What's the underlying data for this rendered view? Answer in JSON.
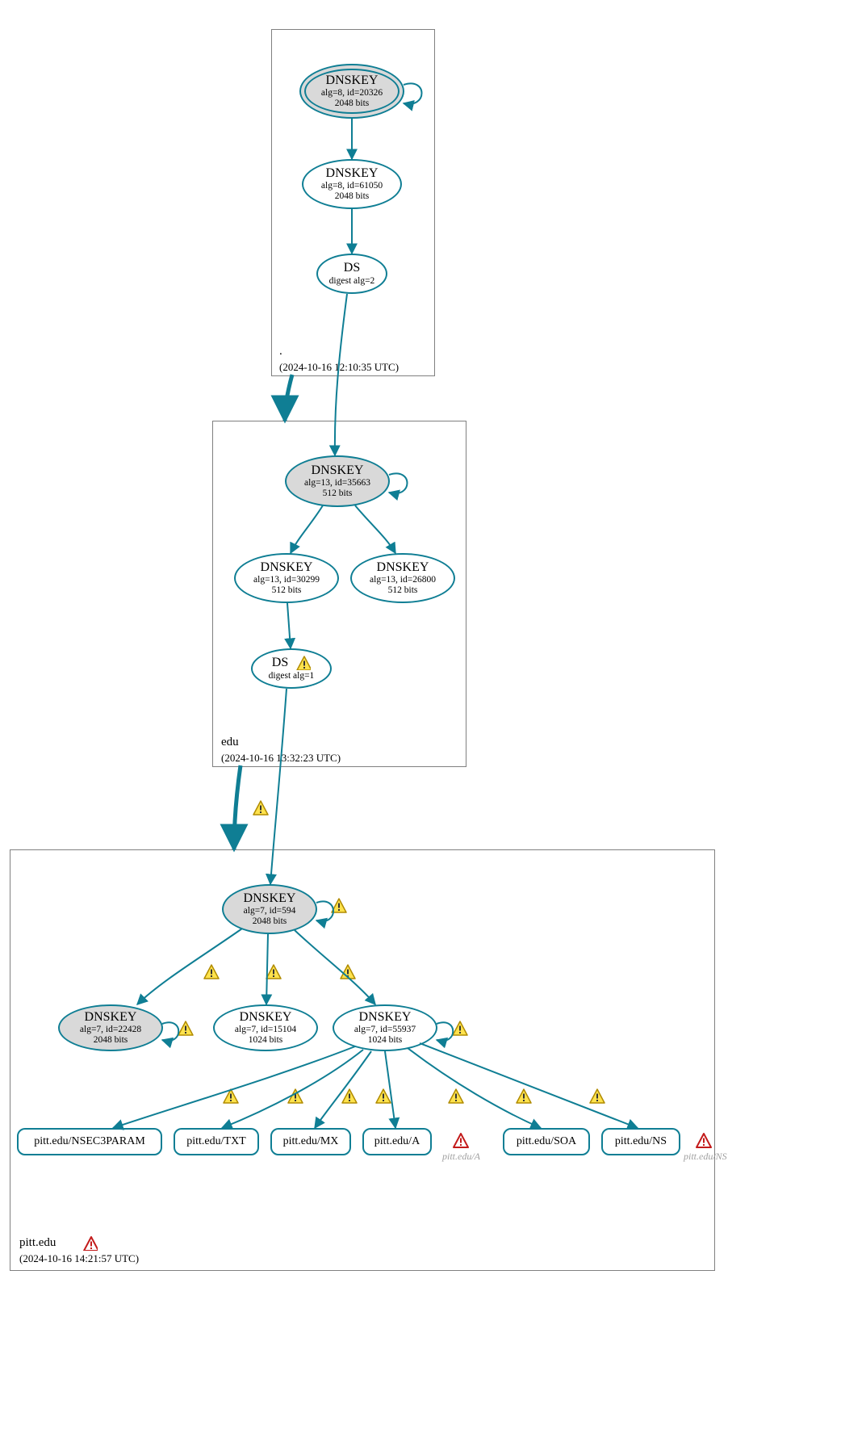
{
  "zones": {
    "root": {
      "name": ".",
      "timestamp": "(2024-10-16 12:10:35 UTC)"
    },
    "edu": {
      "name": "edu",
      "timestamp": "(2024-10-16 13:32:23 UTC)"
    },
    "pitt": {
      "name": "pitt.edu",
      "timestamp": "(2024-10-16 14:21:57 UTC)"
    }
  },
  "nodes": {
    "root_dnskey_ksk": {
      "title": "DNSKEY",
      "sub1": "alg=8, id=20326",
      "sub2": "2048 bits"
    },
    "root_dnskey_zsk": {
      "title": "DNSKEY",
      "sub1": "alg=8, id=61050",
      "sub2": "2048 bits"
    },
    "root_ds": {
      "title": "DS",
      "sub1": "digest alg=2",
      "sub2": ""
    },
    "edu_dnskey_ksk": {
      "title": "DNSKEY",
      "sub1": "alg=13, id=35663",
      "sub2": "512 bits"
    },
    "edu_dnskey_a": {
      "title": "DNSKEY",
      "sub1": "alg=13, id=30299",
      "sub2": "512 bits"
    },
    "edu_dnskey_b": {
      "title": "DNSKEY",
      "sub1": "alg=13, id=26800",
      "sub2": "512 bits"
    },
    "edu_ds": {
      "title": "DS",
      "sub1": "digest alg=1",
      "sub2": ""
    },
    "pitt_dnskey_ksk": {
      "title": "DNSKEY",
      "sub1": "alg=7, id=594",
      "sub2": "2048 bits"
    },
    "pitt_dnskey_a": {
      "title": "DNSKEY",
      "sub1": "alg=7, id=22428",
      "sub2": "2048 bits"
    },
    "pitt_dnskey_b": {
      "title": "DNSKEY",
      "sub1": "alg=7, id=15104",
      "sub2": "1024 bits"
    },
    "pitt_dnskey_c": {
      "title": "DNSKEY",
      "sub1": "alg=7, id=55937",
      "sub2": "1024 bits"
    }
  },
  "rr": {
    "nsec3": "pitt.edu/NSEC3PARAM",
    "txt": "pitt.edu/TXT",
    "mx": "pitt.edu/MX",
    "a": "pitt.edu/A",
    "soa": "pitt.edu/SOA",
    "ns": "pitt.edu/NS"
  },
  "ghosts": {
    "a_ghost": "pitt.edu/A",
    "ns_ghost": "pitt.edu/NS"
  },
  "colors": {
    "stroke": "#0f7e94",
    "warn_fill": "#ffe24d",
    "warn_stroke": "#b08b00",
    "err_stroke": "#c31b1b"
  }
}
